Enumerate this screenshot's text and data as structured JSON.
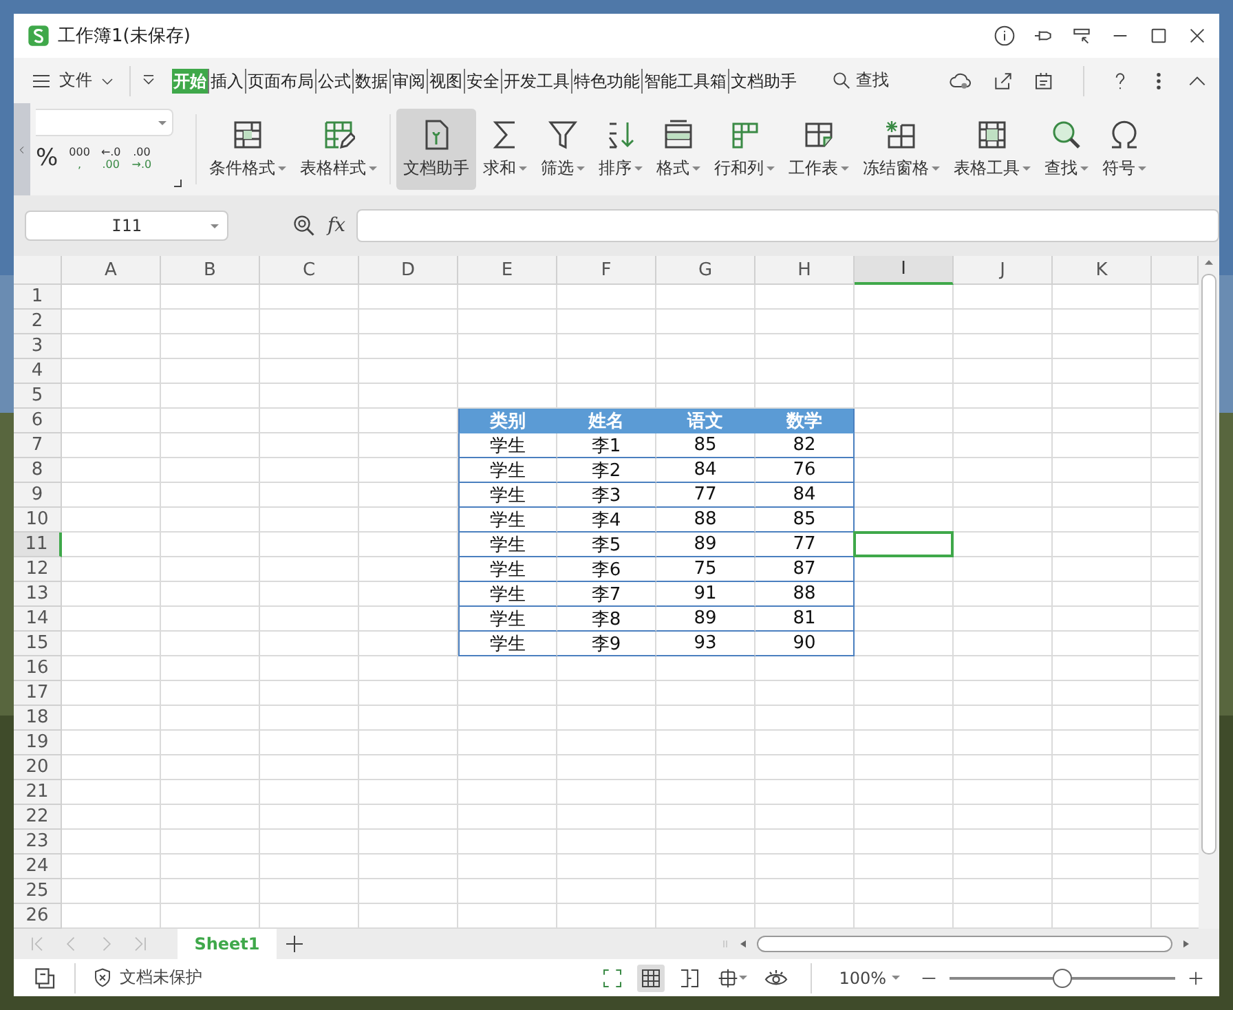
{
  "window": {
    "title": "工作簿1(未保存)"
  },
  "menu": {
    "file": "文件",
    "search": "查找",
    "tabs": [
      {
        "label": "开始",
        "selected": true
      },
      {
        "label": "插入",
        "selected": false
      },
      {
        "label": "页面布局",
        "selected": false
      },
      {
        "label": "公式",
        "selected": false
      },
      {
        "label": "数据",
        "selected": false
      },
      {
        "label": "审阅",
        "selected": false
      },
      {
        "label": "视图",
        "selected": false
      },
      {
        "label": "安全",
        "selected": false
      },
      {
        "label": "开发工具",
        "selected": false
      },
      {
        "label": "特色功能",
        "selected": false
      },
      {
        "label": "智能工具箱",
        "selected": false
      },
      {
        "label": "文档助手",
        "selected": false
      }
    ]
  },
  "ribbon": {
    "number_buttons": [
      {
        "lines": [
          "%"
        ]
      },
      {
        "lines": [
          "000",
          ","
        ]
      },
      {
        "lines": [
          "←.0",
          ".00"
        ]
      },
      {
        "lines": [
          ".00",
          "→.0"
        ]
      }
    ],
    "buttons": [
      {
        "label": "条件格式",
        "dropdown": true,
        "active": false
      },
      {
        "label": "表格样式",
        "dropdown": true,
        "active": false
      },
      {
        "label": "文档助手",
        "dropdown": false,
        "active": true
      },
      {
        "label": "求和",
        "dropdown": true,
        "active": false
      },
      {
        "label": "筛选",
        "dropdown": true,
        "active": false
      },
      {
        "label": "排序",
        "dropdown": true,
        "active": false
      },
      {
        "label": "格式",
        "dropdown": true,
        "active": false
      },
      {
        "label": "行和列",
        "dropdown": true,
        "active": false
      },
      {
        "label": "工作表",
        "dropdown": true,
        "active": false
      },
      {
        "label": "冻结窗格",
        "dropdown": true,
        "active": false
      },
      {
        "label": "表格工具",
        "dropdown": true,
        "active": false
      },
      {
        "label": "查找",
        "dropdown": true,
        "active": false
      },
      {
        "label": "符号",
        "dropdown": true,
        "active": false
      }
    ]
  },
  "formula_bar": {
    "name_box": "I11",
    "fx": "fx"
  },
  "sheet": {
    "columns": [
      {
        "label": "A",
        "selected": false
      },
      {
        "label": "B",
        "selected": false
      },
      {
        "label": "C",
        "selected": false
      },
      {
        "label": "D",
        "selected": false
      },
      {
        "label": "E",
        "selected": false
      },
      {
        "label": "F",
        "selected": false
      },
      {
        "label": "G",
        "selected": false
      },
      {
        "label": "H",
        "selected": false
      },
      {
        "label": "I",
        "selected": true
      },
      {
        "label": "J",
        "selected": false
      },
      {
        "label": "K",
        "selected": false
      }
    ],
    "rows": [
      {
        "label": "1",
        "selected": false
      },
      {
        "label": "2",
        "selected": false
      },
      {
        "label": "3",
        "selected": false
      },
      {
        "label": "4",
        "selected": false
      },
      {
        "label": "5",
        "selected": false
      },
      {
        "label": "6",
        "selected": false
      },
      {
        "label": "7",
        "selected": false
      },
      {
        "label": "8",
        "selected": false
      },
      {
        "label": "9",
        "selected": false
      },
      {
        "label": "10",
        "selected": false
      },
      {
        "label": "11",
        "selected": true
      },
      {
        "label": "12",
        "selected": false
      },
      {
        "label": "13",
        "selected": false
      },
      {
        "label": "14",
        "selected": false
      },
      {
        "label": "15",
        "selected": false
      },
      {
        "label": "16",
        "selected": false
      },
      {
        "label": "17",
        "selected": false
      },
      {
        "label": "18",
        "selected": false
      },
      {
        "label": "19",
        "selected": false
      },
      {
        "label": "20",
        "selected": false
      },
      {
        "label": "21",
        "selected": false
      },
      {
        "label": "22",
        "selected": false
      },
      {
        "label": "23",
        "selected": false
      },
      {
        "label": "24",
        "selected": false
      },
      {
        "label": "25",
        "selected": false
      },
      {
        "label": "26",
        "selected": false
      }
    ],
    "table": {
      "header": [
        "类别",
        "姓名",
        "语文",
        "数学"
      ],
      "rows": [
        [
          "学生",
          "李1",
          "85",
          "82"
        ],
        [
          "学生",
          "李2",
          "84",
          "76"
        ],
        [
          "学生",
          "李3",
          "77",
          "84"
        ],
        [
          "学生",
          "李4",
          "88",
          "85"
        ],
        [
          "学生",
          "李5",
          "89",
          "77"
        ],
        [
          "学生",
          "李6",
          "75",
          "87"
        ],
        [
          "学生",
          "李7",
          "91",
          "88"
        ],
        [
          "学生",
          "李8",
          "89",
          "81"
        ],
        [
          "学生",
          "李9",
          "93",
          "90"
        ]
      ]
    }
  },
  "sheet_tabs": [
    {
      "label": "Sheet1",
      "selected": true
    }
  ],
  "status_bar": {
    "protection": "文档未保护",
    "zoom": "100%",
    "zoom_slider": {
      "level": 0.5
    }
  }
}
